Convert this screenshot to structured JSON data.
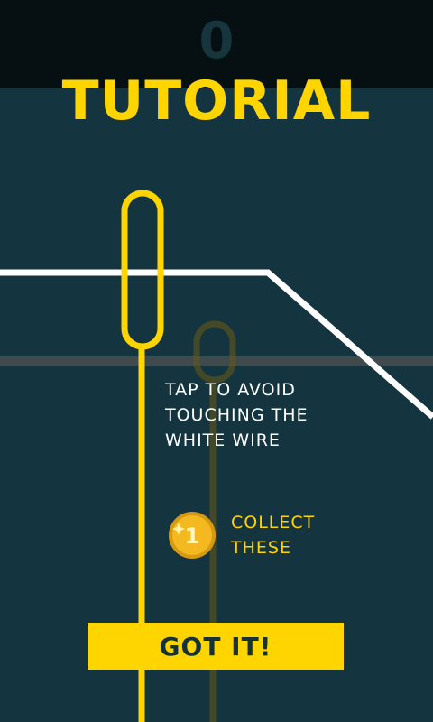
{
  "hud": {
    "score": "0"
  },
  "tutorial": {
    "title": "TUTORIAL",
    "instruction_lines": [
      "TAP TO AVOID",
      "TOUCHING THE",
      "WHITE WIRE"
    ],
    "collect_lines": [
      "COLLECT",
      "THESE"
    ],
    "coin_value": "1",
    "button_label": "GOT IT!"
  },
  "colors": {
    "background": "#14353f",
    "top_bar": "#060f11",
    "accent_yellow": "#ffd500",
    "wire_white": "#ffffff",
    "coin": "#f4b820"
  }
}
